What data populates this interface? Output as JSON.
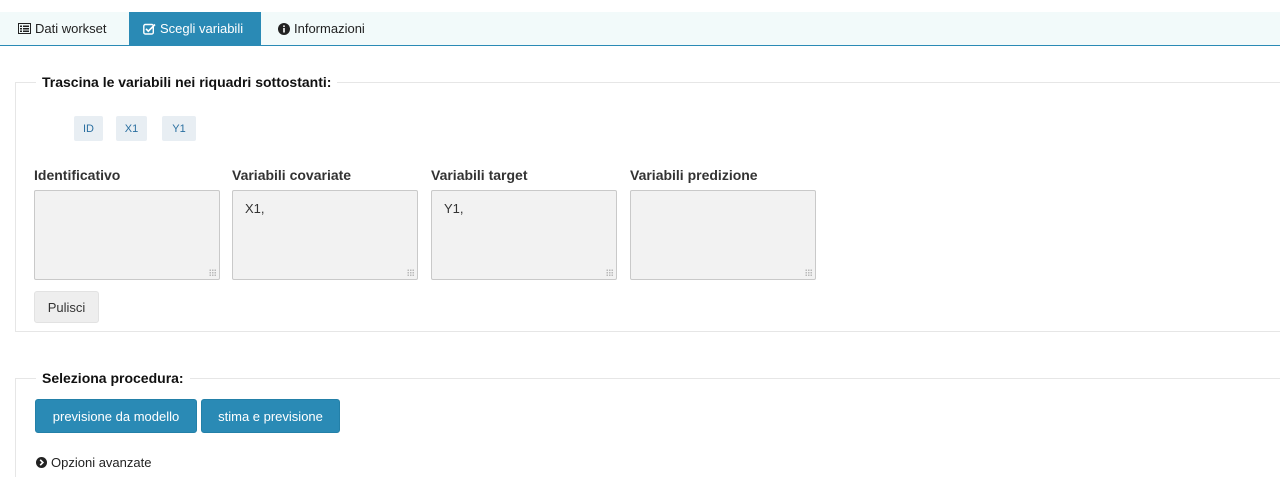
{
  "tabs": [
    {
      "label": "Dati workset",
      "icon": "list-icon",
      "active": false
    },
    {
      "label": "Scegli variabili",
      "icon": "checkbox-icon",
      "active": true
    },
    {
      "label": "Informazioni",
      "icon": "info-icon",
      "active": false
    }
  ],
  "variables_panel": {
    "legend": "Trascina le variabili nei riquadri sottostanti:",
    "chips": [
      "ID",
      "X1",
      "Y1"
    ],
    "columns": [
      {
        "label": "Identificativo",
        "value": ""
      },
      {
        "label": "Variabili covariate",
        "value": "X1,"
      },
      {
        "label": "Variabili target",
        "value": "Y1,"
      },
      {
        "label": "Variabili predizione",
        "value": ""
      }
    ],
    "clear_label": "Pulisci"
  },
  "procedure_panel": {
    "legend": "Seleziona procedura:",
    "buttons": [
      "previsione da modello",
      "stima e previsione"
    ],
    "advanced_label": "Opzioni avanzate"
  },
  "colors": {
    "accent": "#2a8ab5",
    "tabbar_bg": "#f2fafa",
    "chip_bg": "#e8eef3",
    "drop_bg": "#f2f2f2"
  }
}
